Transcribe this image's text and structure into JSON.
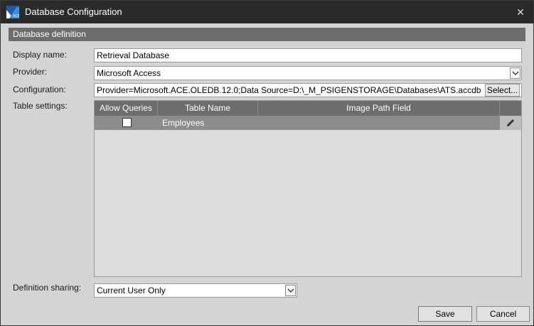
{
  "window": {
    "title": "Database Configuration",
    "icon": "ace-logo-icon",
    "close_glyph": "✕"
  },
  "section": {
    "header": "Database definition"
  },
  "form": {
    "display_name_label": "Display name:",
    "display_name_value": "Retrieval Database",
    "provider_label": "Provider:",
    "provider_value": "Microsoft Access",
    "configuration_label": "Configuration:",
    "configuration_value": "Provider=Microsoft.ACE.OLEDB.12.0;Data Source=D:\\_M_PSIGENSTORAGE\\Databases\\ATS.accdb",
    "select_button": "Select...",
    "table_settings_label": "Table settings:",
    "definition_sharing_label": "Definition sharing:",
    "definition_sharing_value": "Current User Only"
  },
  "table": {
    "columns": [
      "Allow Queries",
      "Table Name",
      "Image Path Field"
    ],
    "rows": [
      {
        "allow_queries": false,
        "table_name": "Employees",
        "image_path_field": ""
      }
    ]
  },
  "buttons": {
    "save": "Save",
    "cancel": "Cancel"
  },
  "colors": {
    "titlebar": "#2b2b2b",
    "background": "#d4d4d4",
    "header": "#6d6d6d",
    "selected_row": "#8c8c8c"
  }
}
